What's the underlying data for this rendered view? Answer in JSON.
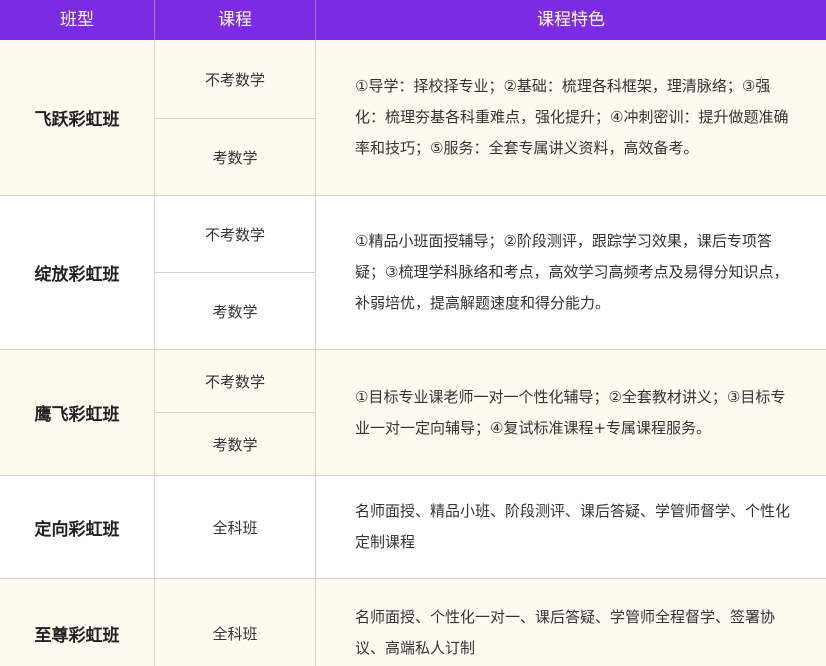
{
  "header": {
    "col_class": "班型",
    "col_course": "课程",
    "col_feature": "课程特色"
  },
  "rows": [
    {
      "name": "飞跃彩虹班",
      "courses": [
        "不考数学",
        "考数学"
      ],
      "feature": "①导学：择校择专业；②基础：梳理各科框架，理清脉络；③强化：梳理夯基各科重难点，强化提升；④冲刺密训：提升做题准确率和技巧；⑤服务：全套专属讲义资料，高效备考。"
    },
    {
      "name": "绽放彩虹班",
      "courses": [
        "不考数学",
        "考数学"
      ],
      "feature": "①精品小班面授辅导；②阶段测评，跟踪学习效果，课后专项答疑；③梳理学科脉络和考点，高效学习高频考点及易得分知识点，补弱培优，提高解题速度和得分能力。"
    },
    {
      "name": "鹰飞彩虹班",
      "courses": [
        "不考数学",
        "考数学"
      ],
      "feature": "①目标专业课老师一对一个性化辅导；②全套教材讲义；③目标专业一对一定向辅导；④复试标准课程+专属课程服务。"
    },
    {
      "name": "定向彩虹班",
      "courses": [
        "全科班"
      ],
      "feature": "名师面授、精品小班、阶段测评、课后答疑、学管师督学、个性化定制课程"
    },
    {
      "name": "至尊彩虹班",
      "courses": [
        "全科班"
      ],
      "feature": "名师面授、个性化一对一、课后答疑、学管师全程督学、签署协议、高端私人订制"
    }
  ]
}
